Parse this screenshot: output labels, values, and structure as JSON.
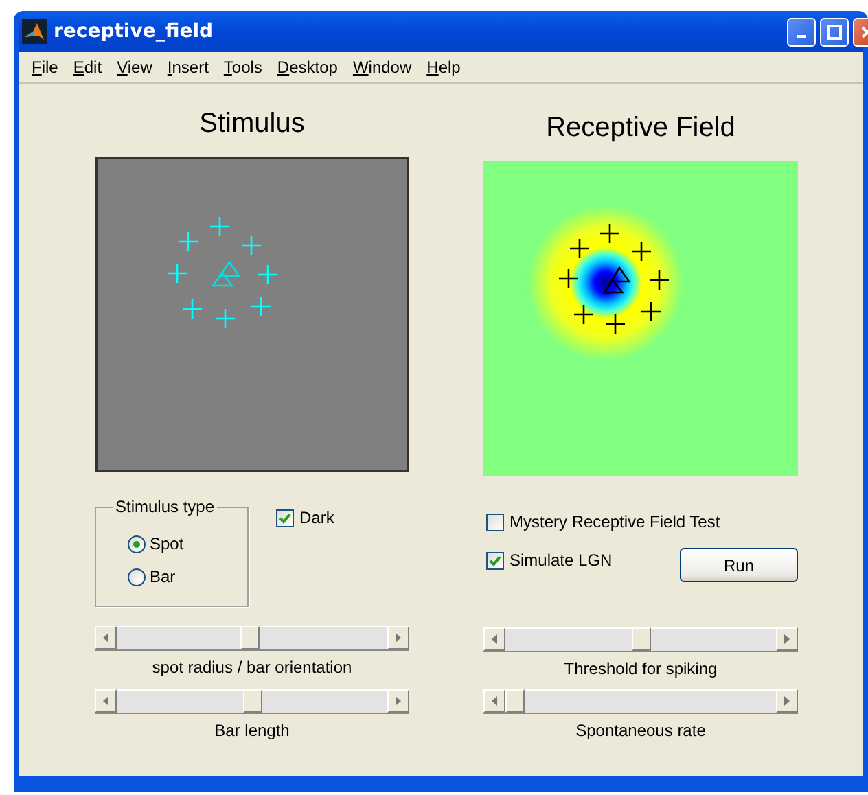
{
  "window": {
    "title": "receptive_field"
  },
  "menu": [
    {
      "label": "File"
    },
    {
      "label": "Edit"
    },
    {
      "label": "View"
    },
    {
      "label": "Insert"
    },
    {
      "label": "Tools"
    },
    {
      "label": "Desktop"
    },
    {
      "label": "Window"
    },
    {
      "label": "Help"
    }
  ],
  "stimulus_panel": {
    "title": "Stimulus"
  },
  "receptive_field_panel": {
    "title": "Receptive Field"
  },
  "stimulus_type": {
    "label": "Stimulus type",
    "options": [
      {
        "label": "Spot",
        "selected": true
      },
      {
        "label": "Bar",
        "selected": false
      }
    ]
  },
  "checkboxes": [
    {
      "label": "Dark",
      "checked": true
    },
    {
      "label": "Mystery Receptive Field Test",
      "checked": false
    },
    {
      "label": "Simulate LGN",
      "checked": true
    }
  ],
  "run_button": {
    "label": "Run"
  },
  "sliders": [
    {
      "label": "spot radius / bar orientation",
      "level": 0.49
    },
    {
      "label": "Bar length",
      "level": 0.5
    },
    {
      "label": "Threshold for spiking",
      "level": 0.5
    },
    {
      "label": "Spontaneous rate",
      "level": 0
    }
  ]
}
